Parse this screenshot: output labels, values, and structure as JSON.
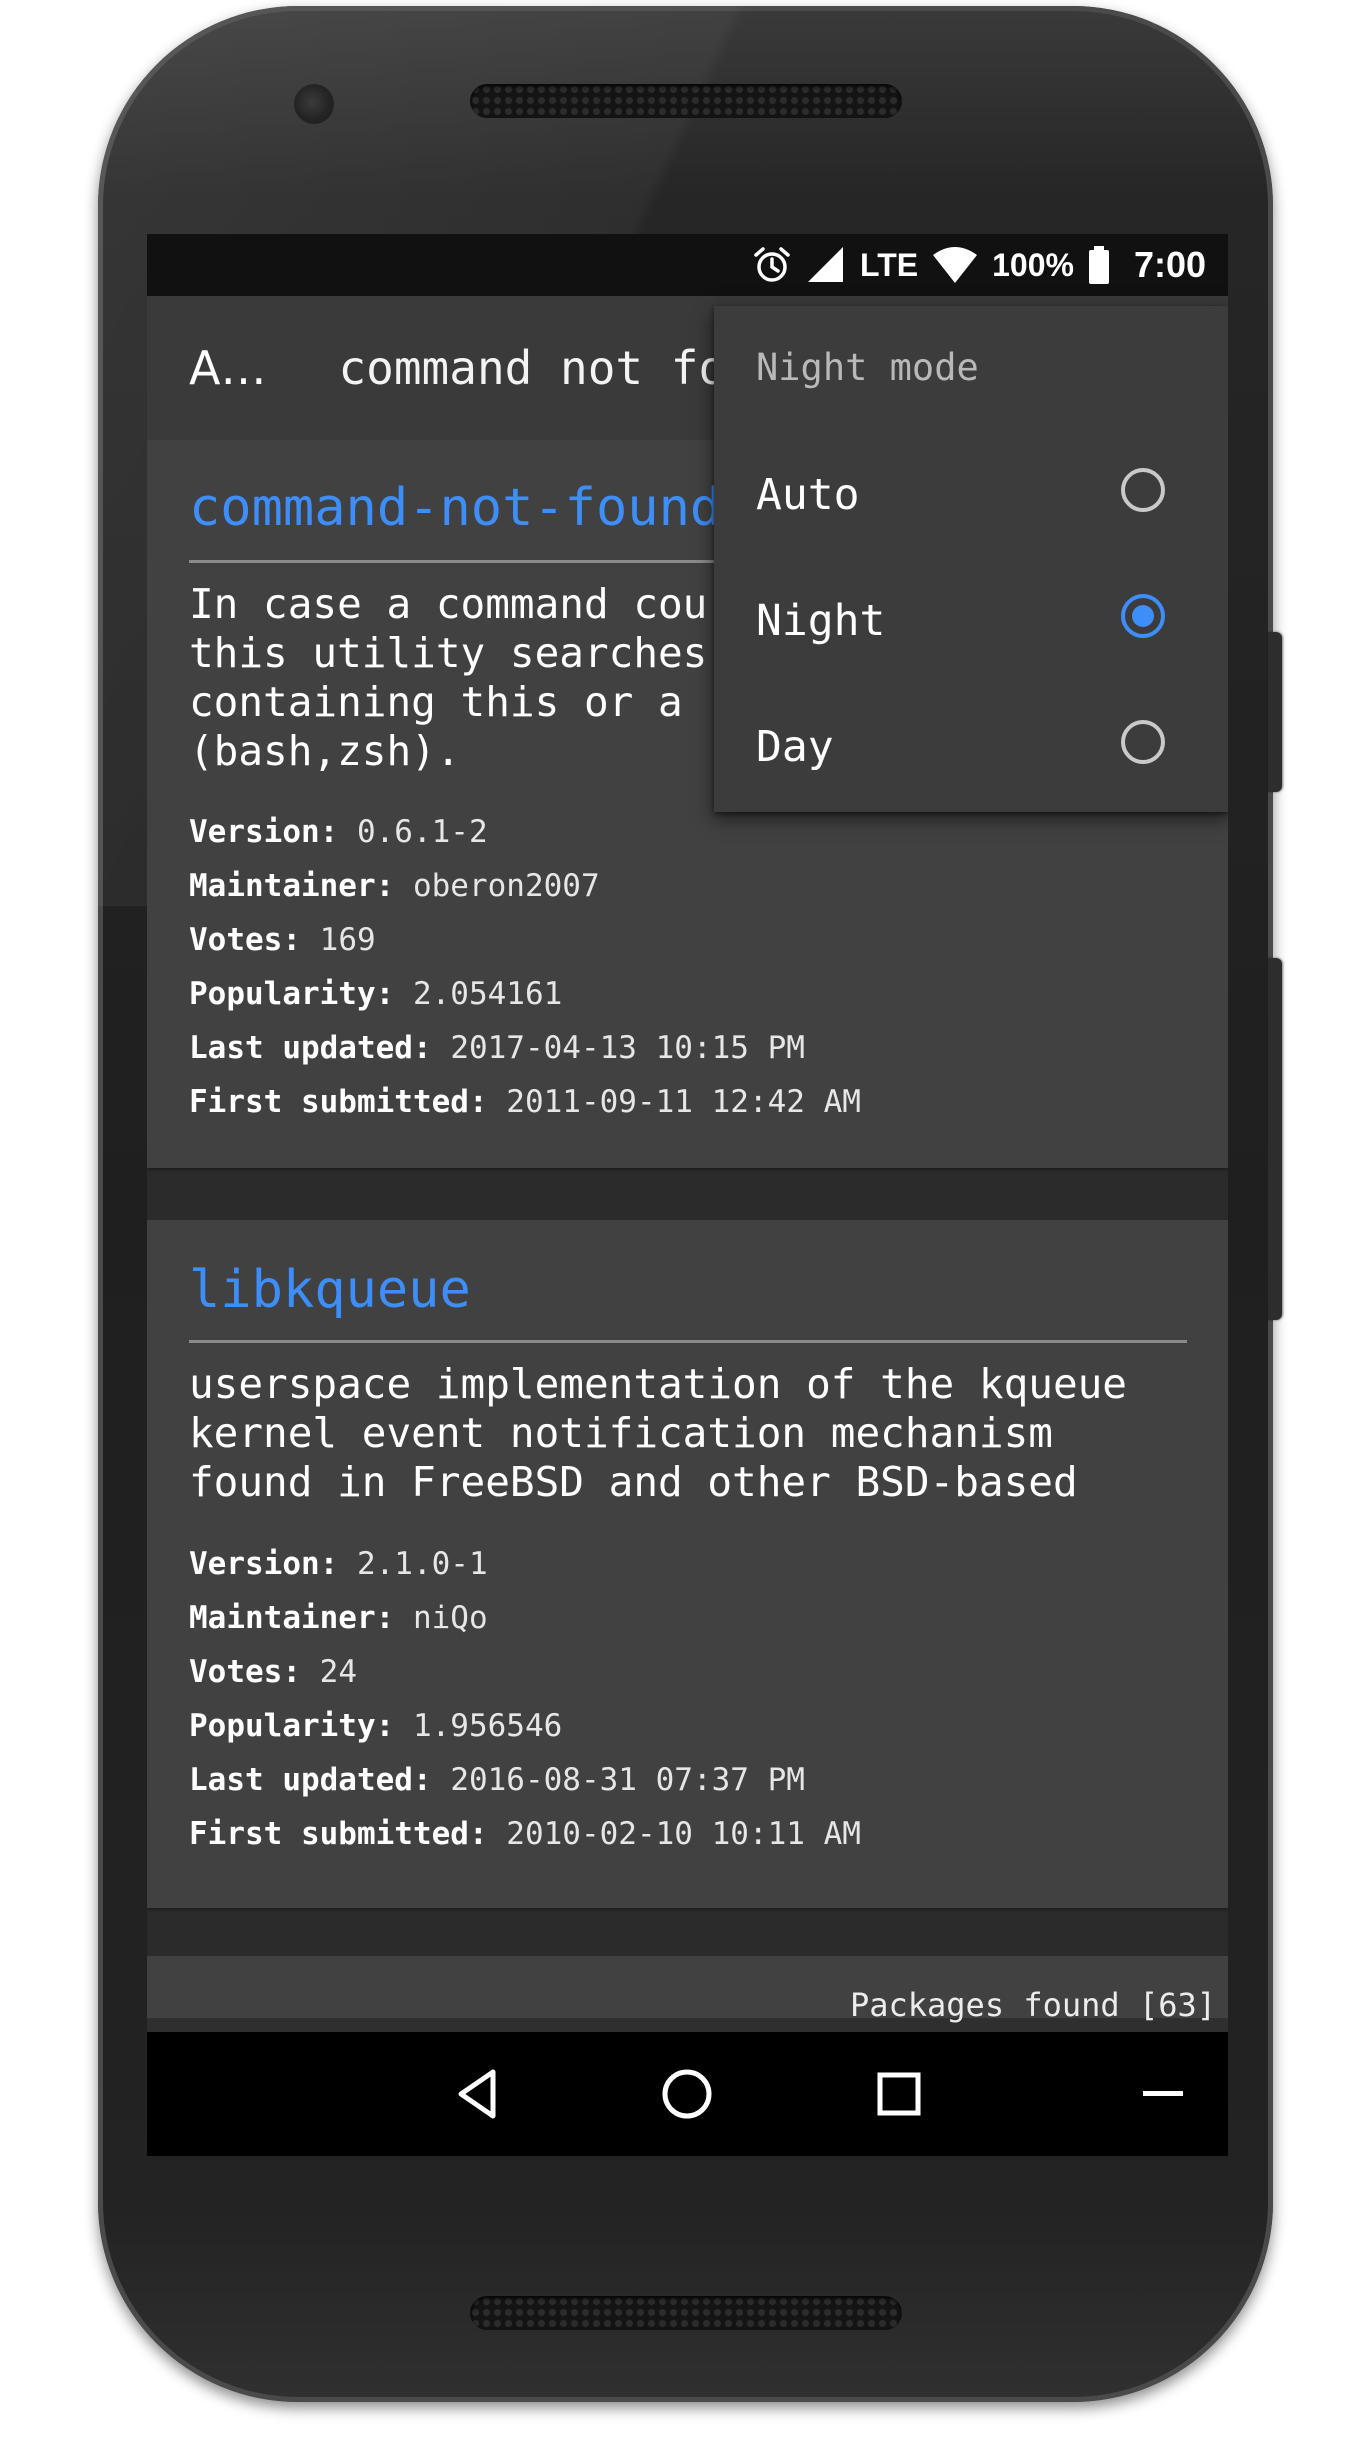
{
  "status_bar": {
    "network": "LTE",
    "battery": "100%",
    "time": "7:00",
    "icons": [
      "alarm-icon",
      "signal-icon",
      "wifi-icon",
      "battery-icon"
    ]
  },
  "toolbar": {
    "app_title": "A…",
    "search_query": "command not fo"
  },
  "popup": {
    "title": "Night mode",
    "options": [
      {
        "label": "Auto",
        "selected": false
      },
      {
        "label": "Night",
        "selected": true
      },
      {
        "label": "Day",
        "selected": false
      }
    ]
  },
  "packages": [
    {
      "name": "command-not-found",
      "description": "In case a command cou\nthis utility searches\ncontaining this or a\n(bash,zsh).",
      "version_label": "Version:",
      "version": "0.6.1-2",
      "maintainer_label": "Maintainer:",
      "maintainer": "oberon2007",
      "votes_label": "Votes:",
      "votes": "169",
      "popularity_label": "Popularity:",
      "popularity": "2.054161",
      "last_updated_label": "Last updated:",
      "last_updated": "2017-04-13 10:15 PM",
      "first_submitted_label": "First submitted:",
      "first_submitted": "2011-09-11 12:42 AM"
    },
    {
      "name": "libkqueue",
      "description": "userspace implementation of the kqueue\nkernel event notification mechanism\nfound in FreeBSD and other BSD-based",
      "version_label": "Version:",
      "version": "2.1.0-1",
      "maintainer_label": "Maintainer:",
      "maintainer": "niQo",
      "votes_label": "Votes:",
      "votes": "24",
      "popularity_label": "Popularity:",
      "popularity": "1.956546",
      "last_updated_label": "Last updated:",
      "last_updated": "2016-08-31 07:37 PM",
      "first_submitted_label": "First submitted:",
      "first_submitted": "2010-02-10 10:11 AM"
    }
  ],
  "footer": {
    "packages_found": "Packages found [63]"
  },
  "colors": {
    "accent": "#3d8ef8",
    "card_background": "#414141",
    "popup_background": "#3c3c3c"
  }
}
